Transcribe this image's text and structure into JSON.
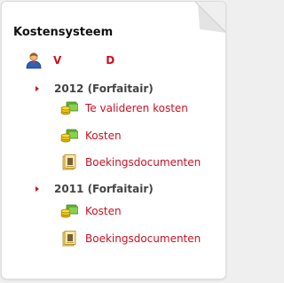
{
  "panel": {
    "title": "Kostensysteem"
  },
  "user": {
    "first": "V",
    "last": "D",
    "icon": "user-icon"
  },
  "years": [
    {
      "label": "2012 (Forfaitair)",
      "items": [
        {
          "label": "Te valideren kosten",
          "icon": "coins-icon"
        },
        {
          "label": "Kosten",
          "icon": "coins-icon"
        },
        {
          "label": "Boekingsdocumenten",
          "icon": "document-icon"
        }
      ]
    },
    {
      "label": "2011 (Forfaitair)",
      "items": [
        {
          "label": "Kosten",
          "icon": "coins-icon"
        },
        {
          "label": "Boekingsdocumenten",
          "icon": "document-icon"
        }
      ]
    }
  ],
  "colors": {
    "accent": "#cc1122",
    "year_text": "#444444",
    "title_text": "#111111"
  }
}
